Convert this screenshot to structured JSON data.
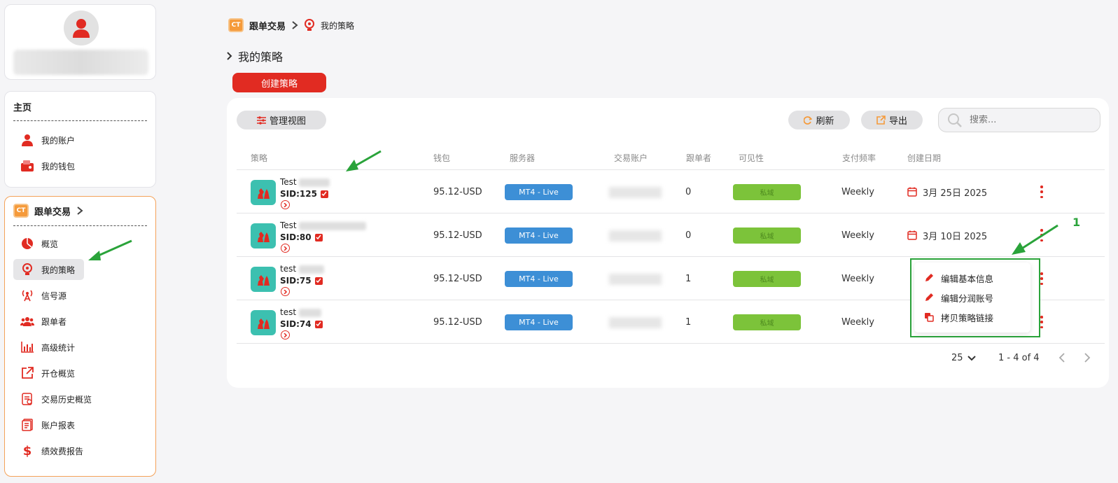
{
  "sidebar": {
    "home_title": "主页",
    "home_items": [
      {
        "label": "我的账户",
        "icon": "user-icon"
      },
      {
        "label": "我的钱包",
        "icon": "wallet-icon"
      }
    ],
    "copy_title": "跟单交易",
    "copy_items": [
      {
        "label": "概览",
        "icon": "pie-chart-icon"
      },
      {
        "label": "我的策略",
        "icon": "lightbulb-gear-icon"
      },
      {
        "label": "信号源",
        "icon": "signal-tower-icon"
      },
      {
        "label": "跟单者",
        "icon": "users-icon"
      },
      {
        "label": "高级统计",
        "icon": "bar-chart-icon"
      },
      {
        "label": "开仓概览",
        "icon": "open-external-icon"
      },
      {
        "label": "交易历史概览",
        "icon": "history-doc-icon"
      },
      {
        "label": "账户报表",
        "icon": "report-doc-icon"
      },
      {
        "label": "绩效费报告",
        "icon": "dollar-icon"
      }
    ]
  },
  "breadcrumb": {
    "logo": "CT",
    "root": "跟单交易",
    "current": "我的策略"
  },
  "page_title": "我的策略",
  "create_button": "创建策略",
  "toolbar": {
    "manage_view": "管理视图",
    "refresh": "刷新",
    "export": "导出",
    "search_placeholder": "搜索..."
  },
  "table": {
    "headers": [
      "策略",
      "钱包",
      "服务器",
      "交易账户",
      "跟单者",
      "可见性",
      "支付频率",
      "创建日期"
    ],
    "rows": [
      {
        "name": "Test",
        "sid": "SID:125",
        "wallet": "95.12-USD",
        "server": "MT4 - Live",
        "followers": "0",
        "visibility": "私域",
        "frequency": "Weekly",
        "date": "3月 25日 2025"
      },
      {
        "name": "Test",
        "sid": "SID:80",
        "wallet": "95.12-USD",
        "server": "MT4 - Live",
        "followers": "0",
        "visibility": "私域",
        "frequency": "Weekly",
        "date": "3月 10日 2025"
      },
      {
        "name": "test",
        "sid": "SID:75",
        "wallet": "95.12-USD",
        "server": "MT4 - Live",
        "followers": "1",
        "visibility": "私域",
        "frequency": "Weekly",
        "date": ""
      },
      {
        "name": "test",
        "sid": "SID:74",
        "wallet": "95.12-USD",
        "server": "MT4 - Live",
        "followers": "1",
        "visibility": "私域",
        "frequency": "Weekly",
        "date": ""
      }
    ]
  },
  "context_menu": {
    "items": [
      "编辑基本信息",
      "编辑分润账号",
      "拷贝策略链接"
    ]
  },
  "pagination": {
    "per_page": "25",
    "range": "1 - 4 of 4"
  },
  "annotation": {
    "number": "1"
  },
  "colors": {
    "brand_red": "#e12b22",
    "server_blue": "#3d8fd6",
    "visibility_green": "#7cc33a",
    "annotation_green": "#2aa33a",
    "accent_orange": "#f59a3a"
  }
}
